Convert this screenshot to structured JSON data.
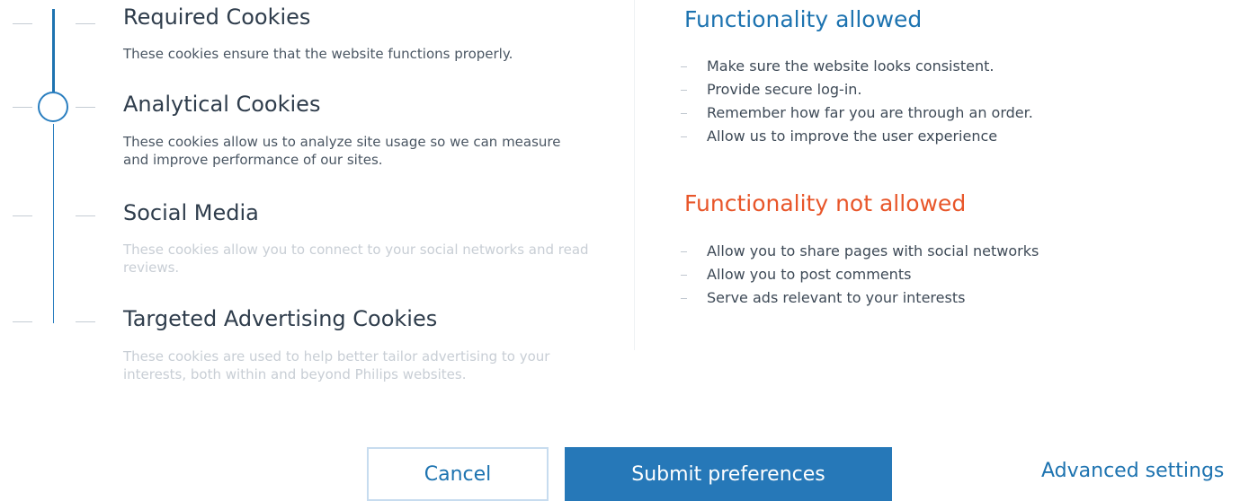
{
  "cookie_levels": {
    "selected_level": "Analytical Cookies",
    "levels": [
      {
        "title": "Required Cookies",
        "description": "These cookies ensure that the website functions properly.",
        "active": true
      },
      {
        "title": "Analytical Cookies",
        "description": "These cookies allow us to analyze site usage so we can measure and improve performance of our sites.",
        "active": true
      },
      {
        "title": "Social Media",
        "description": "These cookies allow you to connect to your social networks and read reviews.",
        "active": false
      },
      {
        "title": "Targeted Advertising Cookies",
        "description": "These cookies are used to help better tailor advertising to your interests, both within and beyond Philips websites.",
        "active": false
      }
    ]
  },
  "functionality": {
    "allowed": {
      "heading": "Functionality allowed",
      "color": "#1d73b0",
      "items": [
        "Make sure the website looks consistent.",
        "Provide secure log-in.",
        "Remember how far you are through an order.",
        "Allow us to improve the user experience"
      ]
    },
    "not_allowed": {
      "heading": "Functionality not allowed",
      "color": "#e8562a",
      "items": [
        "Allow you to share pages with social networks",
        "Allow you to post comments",
        "Serve ads relevant to your interests"
      ]
    }
  },
  "actions": {
    "cancel_label": "Cancel",
    "submit_label": "Submit preferences",
    "advanced_label": "Advanced settings",
    "primary_color": "#2678b8"
  }
}
